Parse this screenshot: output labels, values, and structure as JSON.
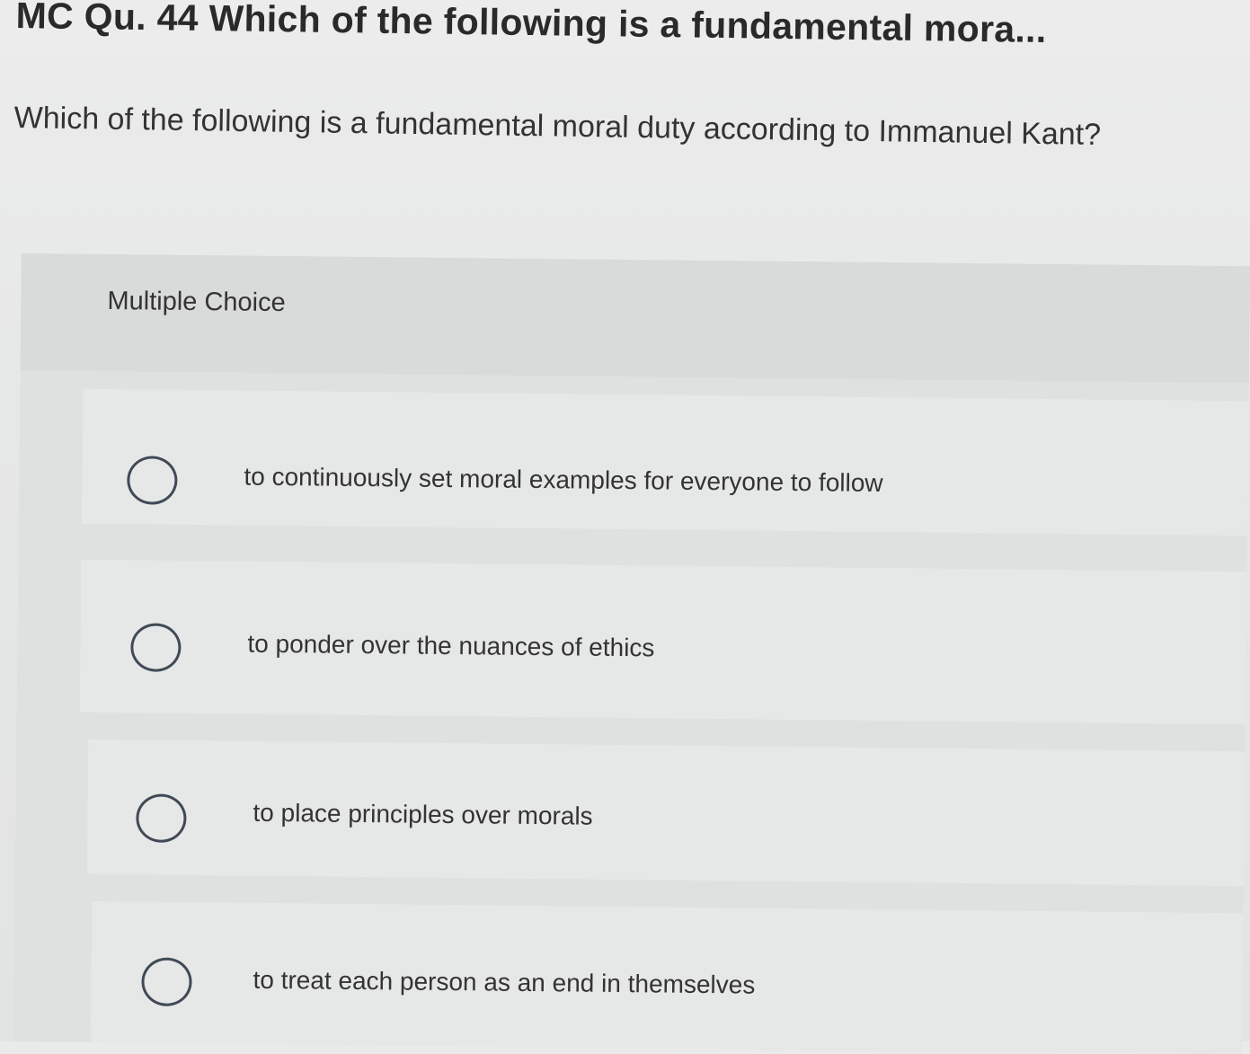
{
  "question": {
    "title": "MC Qu. 44 Which of the following is a fundamental mora...",
    "text": "Which of the following is a fundamental moral duty according to Immanuel Kant?"
  },
  "choices": {
    "label": "Multiple Choice",
    "options": [
      {
        "text": "to continuously set moral examples for everyone to follow",
        "selected": false
      },
      {
        "text": "to ponder over the nuances of ethics",
        "selected": false
      },
      {
        "text": "to place principles over morals",
        "selected": false
      },
      {
        "text": "to treat each person as an end in themselves",
        "selected": false
      }
    ]
  },
  "colors": {
    "radio_border": "#3f4a55",
    "text": "#333333",
    "background": "#e9eaea"
  }
}
